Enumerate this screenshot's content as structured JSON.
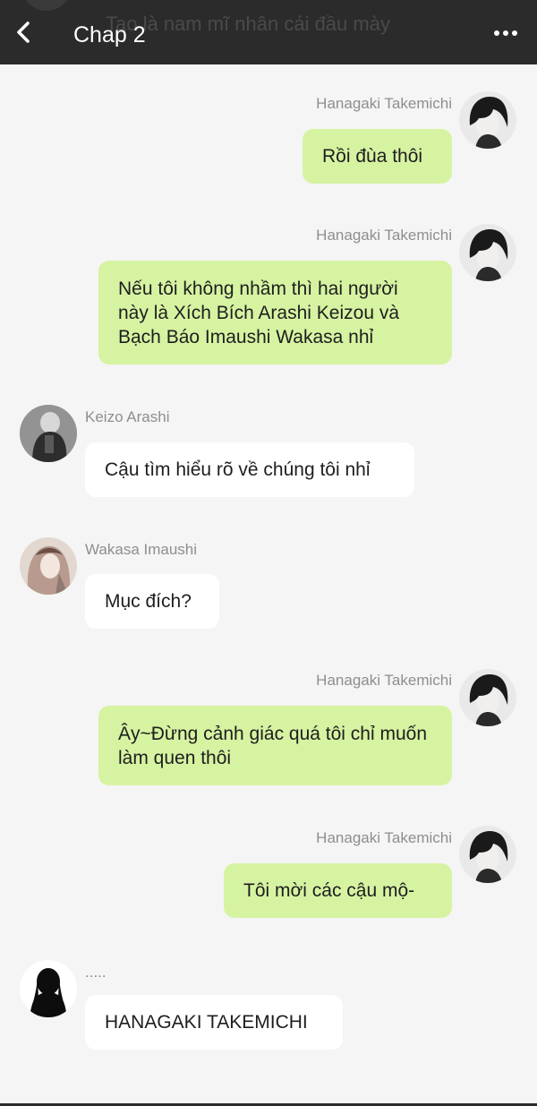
{
  "header": {
    "title": "Chap 2",
    "background_text": "Tao là nam mĩ nhân cái đầu mày",
    "back_icon": "chevron-left-icon",
    "more_icon": "more-horizontal-icon"
  },
  "colors": {
    "header_bg": "#2b2b2b",
    "page_bg": "#f5f5f5",
    "sent_bubble": "#d6f3a2",
    "received_bubble": "#ffffff",
    "name_text": "#8e8e8e"
  },
  "messages": [
    {
      "side": "right",
      "sender": "Hanagaki Takemichi",
      "text": "Rồi đùa thôi"
    },
    {
      "side": "right",
      "sender": "Hanagaki Takemichi",
      "text": "Nếu tôi không nhầm thì hai người này là Xích Bích Arashi Keizou và Bạch Báo Imaushi Wakasa nhỉ"
    },
    {
      "side": "left",
      "sender": "Keizo Arashi",
      "text": "Cậu tìm hiểu rõ về chúng tôi nhỉ"
    },
    {
      "side": "left",
      "sender": "Wakasa Imaushi",
      "text": "Mục đích?"
    },
    {
      "side": "right",
      "sender": "Hanagaki Takemichi",
      "text": "Ây~Đừng cảnh giác quá tôi chỉ muốn làm quen thôi"
    },
    {
      "side": "right",
      "sender": "Hanagaki Takemichi",
      "text": "Tôi mời các cậu mộ-"
    },
    {
      "side": "left",
      "sender": ".....",
      "text": "HANAGAKI TAKEMICHI"
    }
  ]
}
